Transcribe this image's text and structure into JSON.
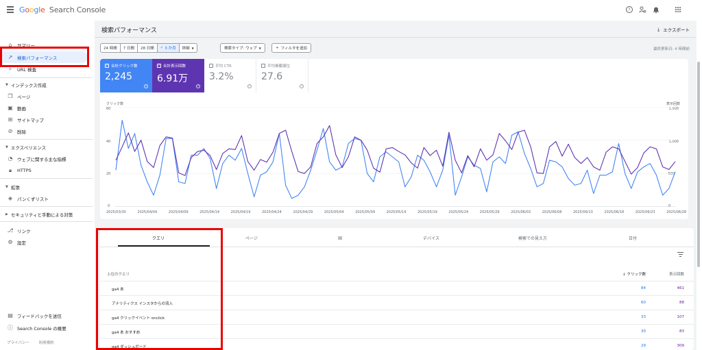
{
  "app": {
    "logo_google": "Google",
    "logo_product": "Search Console"
  },
  "topbar": {
    "icons": [
      "help-icon",
      "account-settings-icon",
      "notifications-icon",
      "apps-grid-icon"
    ]
  },
  "sidebar": {
    "items": [
      {
        "label": "サマリー",
        "icon": "home-icon"
      },
      {
        "label": "検索パフォーマンス",
        "icon": "trending-up-icon"
      },
      {
        "label": "URL 検査",
        "icon": "search-icon"
      }
    ],
    "sections": [
      {
        "title": "インデックス作成",
        "items": [
          {
            "label": "ページ",
            "icon": "pages-icon"
          },
          {
            "label": "動画",
            "icon": "video-icon"
          },
          {
            "label": "サイトマップ",
            "icon": "sitemap-icon"
          },
          {
            "label": "削除",
            "icon": "removal-icon"
          }
        ]
      },
      {
        "title": "エクスペリエンス",
        "items": [
          {
            "label": "ウェブに関する主な指標",
            "icon": "speed-icon"
          },
          {
            "label": "HTTPS",
            "icon": "lock-icon"
          }
        ]
      },
      {
        "title": "拡張",
        "items": [
          {
            "label": "パンくずリスト",
            "icon": "layers-icon"
          }
        ]
      },
      {
        "title": "セキュリティと手動による対策",
        "items": []
      }
    ],
    "bottom_items": [
      {
        "label": "リンク",
        "icon": "links-icon"
      },
      {
        "label": "設定",
        "icon": "settings-icon"
      }
    ],
    "footer_items": [
      {
        "label": "フィードバックを送信",
        "icon": "feedback-icon"
      },
      {
        "label": "Search Console の概要",
        "icon": "info-icon"
      }
    ],
    "legal": [
      "プライバシー",
      "利用規約"
    ]
  },
  "header": {
    "title": "検索パフォーマンス",
    "export_label": "エクスポート"
  },
  "filters": {
    "date_ranges": [
      "24 時間",
      "7 日間",
      "28 日間",
      "3 か月",
      "詳細"
    ],
    "selected_date_range": "3 か月",
    "search_type": "検索タイプ: ウェブ",
    "add_filter": "フィルタを追加",
    "last_updated": "最終更新日: 4 時間前"
  },
  "metrics": [
    {
      "label": "合計クリック数",
      "value": "2,245",
      "checked": true,
      "color": "#4285f4"
    },
    {
      "label": "合計表示回数",
      "value": "6.91万",
      "checked": true,
      "color": "#5e35b1"
    },
    {
      "label": "平均 CTR",
      "value": "3.2%",
      "checked": false
    },
    {
      "label": "平均掲載順位",
      "value": "27.6",
      "checked": false
    }
  ],
  "chart_data": {
    "type": "line",
    "left_axis_title": "クリック数",
    "right_axis_title": "表示回数",
    "left_ticks": [
      "60",
      "40",
      "20",
      "0"
    ],
    "right_ticks": [
      "1,500",
      "1,000",
      "500",
      "0"
    ],
    "ylim_left": [
      0,
      60
    ],
    "ylim_right": [
      0,
      1500
    ],
    "x_ticks": [
      "2025/03/30",
      "2025/04/04",
      "2025/04/09",
      "2025/04/14",
      "2025/04/19",
      "2025/04/24",
      "2025/04/29",
      "2025/05/04",
      "2025/05/09",
      "2025/05/14",
      "2025/05/19",
      "2025/05/24",
      "2025/05/29",
      "2025/06/03",
      "2025/06/08",
      "2025/06/13",
      "2025/06/18",
      "2025/06/23",
      "2025/06/28"
    ],
    "series": [
      {
        "name": "クリック数",
        "color": "#4285f4",
        "axis": "left",
        "values": [
          22,
          52,
          35,
          44,
          25,
          15,
          7,
          19,
          41,
          41,
          15,
          14,
          31,
          31,
          35,
          29,
          11,
          26,
          31,
          28,
          35,
          20,
          6,
          19,
          21,
          27,
          44,
          13,
          5,
          7,
          12,
          22,
          34,
          47,
          27,
          22,
          24,
          38,
          41,
          40,
          20,
          15,
          30,
          33,
          30,
          27,
          12,
          18,
          31,
          28,
          21,
          12,
          22,
          43,
          7,
          18,
          30,
          25,
          23,
          9,
          27,
          30,
          26,
          43,
          45,
          32,
          23,
          12,
          14,
          28,
          27,
          24,
          17,
          13,
          14,
          22,
          8,
          19,
          19,
          21,
          38,
          20,
          11,
          21,
          24,
          26,
          19,
          7,
          11,
          21
        ]
      },
      {
        "name": "表示回数",
        "color": "#5e35b1",
        "axis": "right",
        "values": [
          700,
          900,
          1110,
          830,
          1000,
          680,
          590,
          920,
          1050,
          1030,
          510,
          470,
          740,
          830,
          850,
          770,
          560,
          800,
          870,
          860,
          1070,
          680,
          550,
          710,
          670,
          820,
          1100,
          1150,
          830,
          530,
          500,
          600,
          950,
          1050,
          1220,
          780,
          590,
          750,
          1050,
          1000,
          850,
          580,
          520,
          870,
          890,
          830,
          780,
          660,
          580,
          890,
          770,
          850,
          610,
          1120,
          700,
          510,
          770,
          600,
          870,
          700,
          780,
          1100,
          990,
          860,
          1120,
          1150,
          900,
          510,
          500,
          900,
          980,
          760,
          940,
          740,
          650,
          740,
          600,
          550,
          820,
          900,
          870,
          680,
          490,
          590,
          810,
          900,
          870,
          600,
          560,
          680
        ]
      }
    ]
  },
  "table": {
    "tabs": [
      "クエリ",
      "ページ",
      "国",
      "デバイス",
      "検索での見え方",
      "日付"
    ],
    "active_tab": "クエリ",
    "col_query": "上位のクエリ",
    "col_clicks": "クリック数",
    "col_impressions": "表示回数",
    "rows": [
      {
        "query": "ga4 本",
        "clicks": "84",
        "impressions": "461"
      },
      {
        "query": "アナリティクス インスタからの流入",
        "clicks": "60",
        "impressions": "88"
      },
      {
        "query": "ga4 クリックイベント onclick",
        "clicks": "33",
        "impressions": "107"
      },
      {
        "query": "ga4 本 おすすめ",
        "clicks": "30",
        "impressions": "83"
      },
      {
        "query": "ga4 ダッシュボード",
        "clicks": "29",
        "impressions": "309"
      }
    ]
  },
  "colors": {
    "highlight_box": "#e90000",
    "clicks": "#4285f4",
    "impressions": "#5e35b1"
  }
}
